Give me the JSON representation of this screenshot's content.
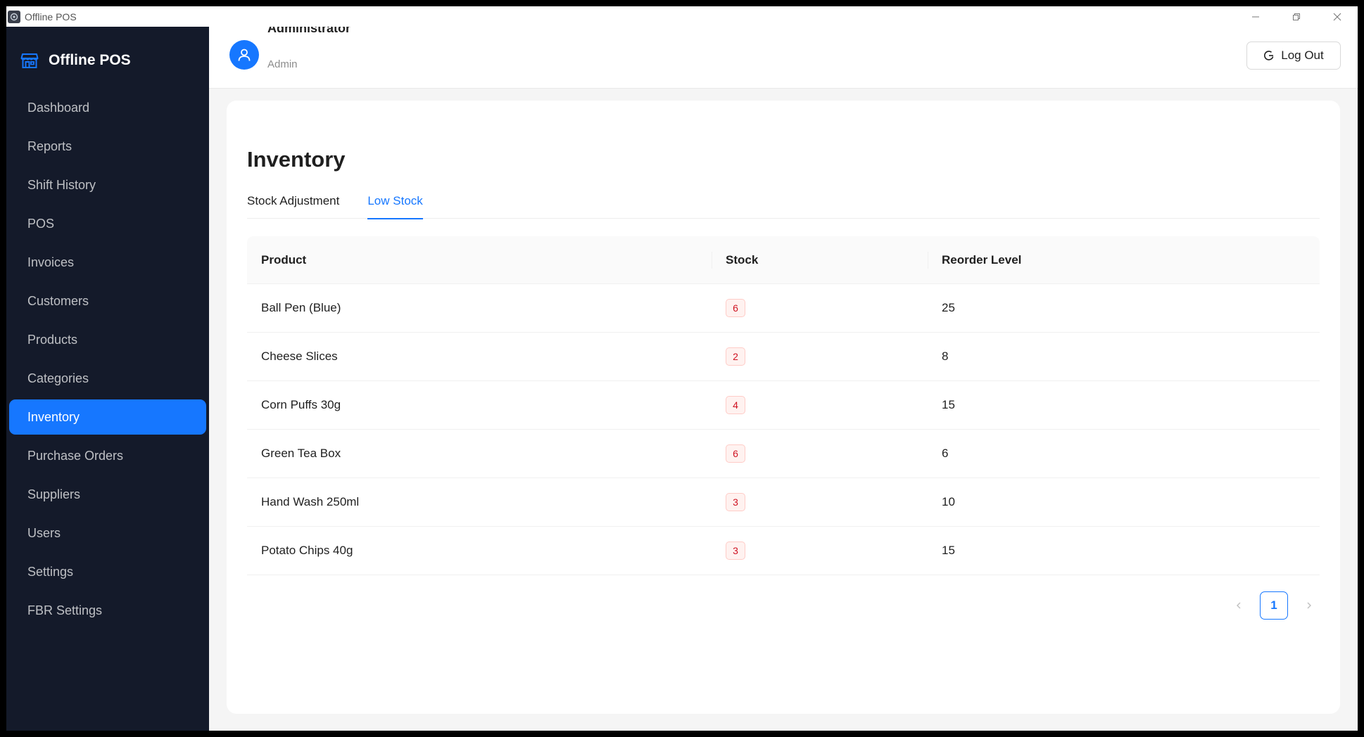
{
  "window": {
    "title": "Offline POS"
  },
  "sidebar": {
    "brand": "Offline POS",
    "items": [
      {
        "label": "Dashboard",
        "active": false
      },
      {
        "label": "Reports",
        "active": false
      },
      {
        "label": "Shift History",
        "active": false
      },
      {
        "label": "POS",
        "active": false
      },
      {
        "label": "Invoices",
        "active": false
      },
      {
        "label": "Customers",
        "active": false
      },
      {
        "label": "Products",
        "active": false
      },
      {
        "label": "Categories",
        "active": false
      },
      {
        "label": "Inventory",
        "active": true
      },
      {
        "label": "Purchase Orders",
        "active": false
      },
      {
        "label": "Suppliers",
        "active": false
      },
      {
        "label": "Users",
        "active": false
      },
      {
        "label": "Settings",
        "active": false
      },
      {
        "label": "FBR Settings",
        "active": false
      }
    ]
  },
  "header": {
    "user_name": "Administrator",
    "user_role": "Admin",
    "logout_label": "Log Out"
  },
  "main": {
    "title": "Inventory",
    "tabs": [
      {
        "label": "Stock Adjustment",
        "active": false
      },
      {
        "label": "Low Stock",
        "active": true
      }
    ],
    "table": {
      "columns": [
        "Product",
        "Stock",
        "Reorder Level"
      ],
      "rows": [
        {
          "product": "Ball Pen (Blue)",
          "stock": "6",
          "reorder": "25"
        },
        {
          "product": "Cheese Slices",
          "stock": "2",
          "reorder": "8"
        },
        {
          "product": "Corn Puffs 30g",
          "stock": "4",
          "reorder": "15"
        },
        {
          "product": "Green Tea Box",
          "stock": "6",
          "reorder": "6"
        },
        {
          "product": "Hand Wash 250ml",
          "stock": "3",
          "reorder": "10"
        },
        {
          "product": "Potato Chips 40g",
          "stock": "3",
          "reorder": "15"
        }
      ]
    },
    "pagination": {
      "current_page": "1"
    }
  },
  "colors": {
    "accent": "#1677ff",
    "sidebar_bg": "#141a2a",
    "badge_red": "#cf1322"
  }
}
